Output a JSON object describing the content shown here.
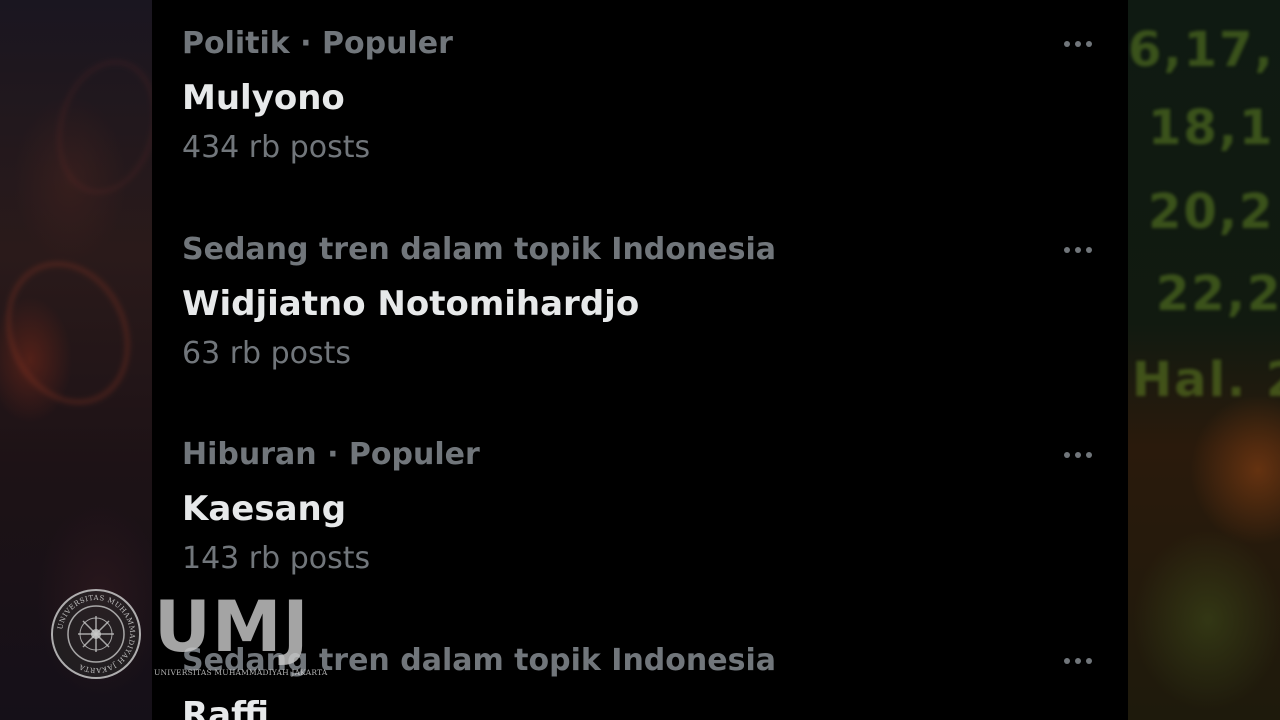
{
  "trends": [
    {
      "context": "Politik · Populer",
      "title": "Mulyono",
      "count": "434 rb posts",
      "more_icon": "more-horizontal-icon"
    },
    {
      "context": "Sedang tren dalam topik Indonesia",
      "title": "Widjiatno Notomihardjo",
      "count": "63 rb posts",
      "more_icon": "more-horizontal-icon"
    },
    {
      "context": "Hiburan · Populer",
      "title": "Kaesang",
      "count": "143 rb posts",
      "more_icon": "more-horizontal-icon"
    },
    {
      "context": "Sedang tren dalam topik Indonesia",
      "title": "Raffi",
      "count": "",
      "more_icon": "more-horizontal-icon"
    }
  ],
  "watermark": {
    "wordmark": "UMJ",
    "subline": "UNIVERSITAS MUHAMMADIYAH JAKARTA",
    "seal_text": "UNIVERSITAS MUHAMMADIYAH JAKARTA"
  },
  "background": {
    "right_numbers": [
      "6,17,",
      "18,1",
      "20,2",
      "22,2",
      "Hal. 2"
    ]
  },
  "colors": {
    "feed_background": "#000000",
    "primary_text": "#e7e9ea",
    "secondary_text": "#71767b"
  }
}
